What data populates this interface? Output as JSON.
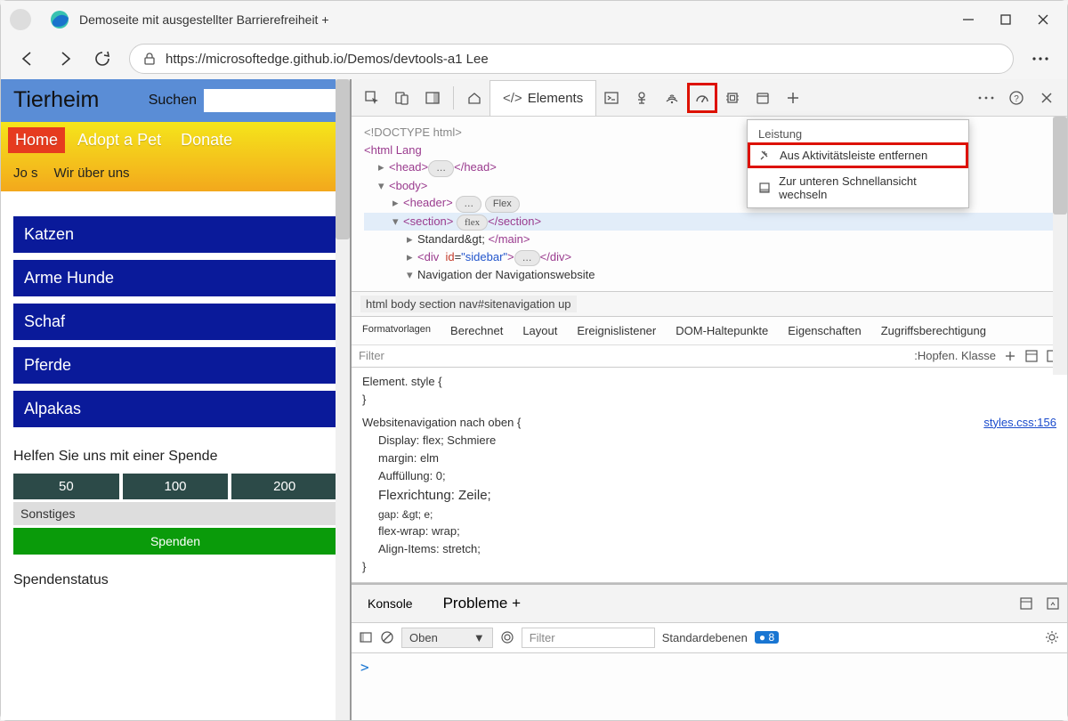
{
  "window": {
    "tab_title": "Demoseite mit ausgestellter Barrierefreiheit +",
    "url": "https://microsoftedge.github.io/Demos/devtools-a1 Lee"
  },
  "page": {
    "brand": "Tierheim",
    "search_label": "Suchen",
    "nav": {
      "home": "Home",
      "adopt": "Adopt a Pet",
      "donate": "Donate",
      "jos": "Jo s",
      "about": "Wir über uns"
    },
    "categories": [
      "Katzen",
      "Arme Hunde",
      "Schaf",
      "Pferde",
      "Alpakas"
    ],
    "donate_title": "Helfen Sie uns mit einer Spende",
    "donate_amounts": [
      "50",
      "100",
      "200"
    ],
    "other_label": "Sonstiges",
    "donate_button": "Spenden",
    "status_title": "Spendenstatus"
  },
  "devtools": {
    "tabs": {
      "elements": "Elements"
    },
    "context_menu": {
      "header": "Leistung",
      "remove": "Aus Aktivitätsleiste entfernen",
      "move": "Zur unteren Schnellansicht wechseln"
    },
    "dom": {
      "doctype": "<!DOCTYPE html>",
      "html_open": "<html Lang",
      "head": "<head>",
      "head_close": "</head>",
      "body": "<body>",
      "header": "<header>",
      "flex_pill": "Flex",
      "section_open": "<section>",
      "section_flex": "flex",
      "section_close": "</section>",
      "main": "Standard&gt;",
      "main_close": "</main>",
      "div_open": "<div",
      "div_attr_name": "id",
      "div_attr_val": "\"sidebar\"",
      "div_close": "</div>",
      "nav_text": "Navigation der Navigationswebsite",
      "dots": "…"
    },
    "breadcrumb": "html body section nav#sitenavigation up",
    "style_tabs": {
      "formats": "Formatvorlagen",
      "computed": "Berechnet",
      "layout": "Layout",
      "listeners": "Ereignislistener",
      "dom_bp": "DOM-Haltepunkte",
      "props": "Eigenschaften",
      "a11y": "Zugriffsberechtigung"
    },
    "filter_placeholder": "Filter",
    "hov_label": ":Hopfen. Klasse",
    "styles": {
      "element_style": "Element. style {",
      "close": "}",
      "selector": "Websitenavigation nach oben {",
      "rules": [
        "Display: flex; Schmiere",
        "margin: elm",
        "Auffüllung: 0;",
        "Flexrichtung: Zeile;",
        "gap: &gt; e;",
        "flex-wrap: wrap;",
        "Align-Items: stretch;"
      ],
      "source_link": "styles.css:156"
    },
    "drawer": {
      "console_tab": "Konsole",
      "problems_tab": "Probleme +",
      "level": "Oben",
      "filter": "Filter",
      "default_levels": "Standardebenen",
      "issue_count": "8",
      "prompt": ">"
    }
  }
}
